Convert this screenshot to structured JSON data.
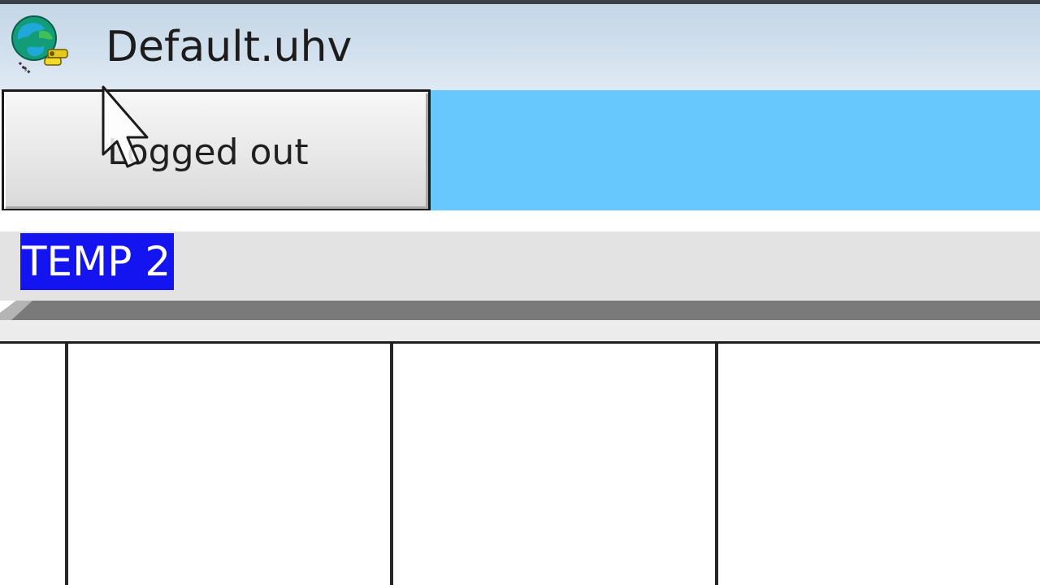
{
  "window": {
    "title": "Default.uhv",
    "icon": "globe-keys-icon"
  },
  "login_status": {
    "label": "Logged out"
  },
  "field": {
    "value": "TEMP 2",
    "selected": true
  },
  "colors": {
    "status_band": "#66c8fc",
    "selection": "#1414f0",
    "titlebar": "#cfdeec"
  }
}
